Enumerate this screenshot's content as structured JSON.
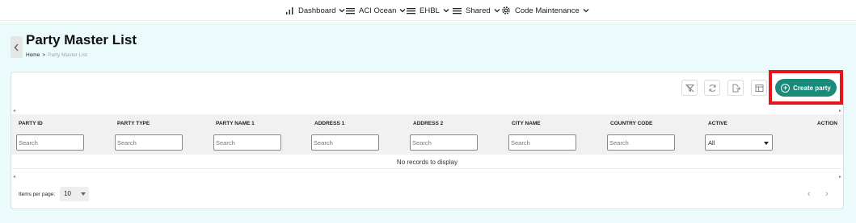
{
  "nav": {
    "items": [
      {
        "label": "Dashboard",
        "icon": "bar-chart-icon"
      },
      {
        "label": "ACI Ocean",
        "icon": "menu-icon"
      },
      {
        "label": "EHBL",
        "icon": "menu-icon"
      },
      {
        "label": "Shared",
        "icon": "menu-icon"
      },
      {
        "label": "Code Maintenance",
        "icon": "gear-icon"
      }
    ]
  },
  "page": {
    "title": "Party Master List",
    "breadcrumb": {
      "home": "Home",
      "separator": ">",
      "current": "Party Master List"
    }
  },
  "toolbar": {
    "create_label": "Create party",
    "tools": [
      "clear-filter-icon",
      "refresh-icon",
      "export-icon",
      "columns-icon"
    ]
  },
  "table": {
    "columns": [
      "PARTY ID",
      "PARTY TYPE",
      "PARTY NAME 1",
      "ADDRESS 1",
      "ADDRESS 2",
      "CITY NAME",
      "COUNTRY CODE",
      "ACTIVE",
      "ACTION"
    ],
    "filter_placeholder": "Search",
    "active_filter_value": "All",
    "empty_message": "No records to display"
  },
  "footer": {
    "items_per_page_label": "Items per page:",
    "items_per_page_value": "10"
  },
  "colors": {
    "accent": "#1a8a7a",
    "page_bg": "#ebfbfc",
    "highlight": "#e8141c"
  }
}
